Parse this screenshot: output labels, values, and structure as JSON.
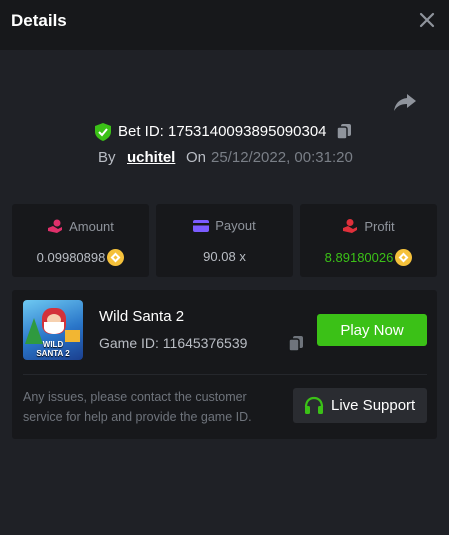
{
  "header": {
    "title": "Details"
  },
  "bet": {
    "id_text": "Bet ID: 1753140093895090304",
    "by_label": "By",
    "user": "uchitel",
    "on_label": "On",
    "datetime": "25/12/2022, 00:31:20"
  },
  "stats": {
    "amount": {
      "label": "Amount",
      "value": "0.09980898"
    },
    "payout": {
      "label": "Payout",
      "value": "90.08 x"
    },
    "profit": {
      "label": "Profit",
      "value": "8.89180026"
    }
  },
  "game": {
    "thumb_text_1": "WILD",
    "thumb_text_2": "SANTA 2",
    "name": "Wild Santa 2",
    "id_text": "Game ID: 11645376539",
    "play_label": "Play Now",
    "note": "Any issues, please contact the customer service for help and provide the game ID.",
    "support_label": "Live Support"
  },
  "icons": {
    "close": "close-icon",
    "share": "share-icon",
    "shield": "shield-check-icon",
    "copy": "copy-icon",
    "amount": "hand-coin-icon",
    "payout": "card-icon",
    "profit": "hand-money-icon",
    "coin": "coin-icon",
    "support": "headset-icon"
  },
  "colors": {
    "accent_green": "#3bc117",
    "coin_gold": "#f5c13b",
    "amount_icon": "#e0306b",
    "payout_icon": "#7b5cff",
    "profit_icon": "#e0303b"
  }
}
